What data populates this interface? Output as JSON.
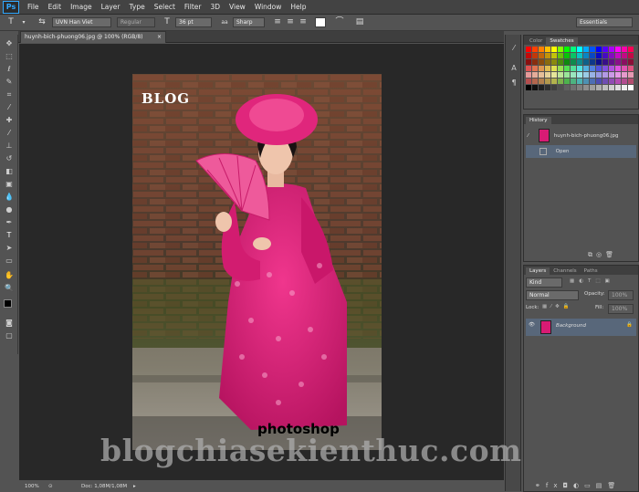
{
  "app": {
    "logo": "Ps"
  },
  "menu": [
    "File",
    "Edit",
    "Image",
    "Layer",
    "Type",
    "Select",
    "Filter",
    "3D",
    "View",
    "Window",
    "Help"
  ],
  "options": {
    "font_family": "UVN Han Viet",
    "font_style": "Regular",
    "font_size": "36 pt",
    "antialias": "Sharp",
    "workspace": "Essentials"
  },
  "document": {
    "tab_title": "huynh-bich-phuong06.jpg @ 100% (RGB/8)",
    "zoom": "100%",
    "doc_info": "Doc: 1,08M/1,08M"
  },
  "photo": {
    "overlay_top": "BLOG",
    "overlay_bottom": "photoshop"
  },
  "panels": {
    "color_tabs": [
      "Color",
      "Swatches"
    ],
    "history": {
      "title": "History",
      "snapshot": "huynh-bich-phuong06.jpg",
      "steps": [
        "Open"
      ]
    },
    "layers": {
      "tabs": [
        "Layers",
        "Channels",
        "Paths"
      ],
      "filter": "Kind",
      "blend_mode": "Normal",
      "opacity_label": "Opacity:",
      "opacity": "100%",
      "lock_label": "Lock:",
      "fill_label": "Fill:",
      "fill": "100%",
      "items": [
        {
          "name": "Background"
        }
      ]
    }
  },
  "watermark": "blogchiasekienthuc.com",
  "colors": {
    "accent": "#31a8ff",
    "selection": "#58677a",
    "dress": "#d81b74"
  }
}
